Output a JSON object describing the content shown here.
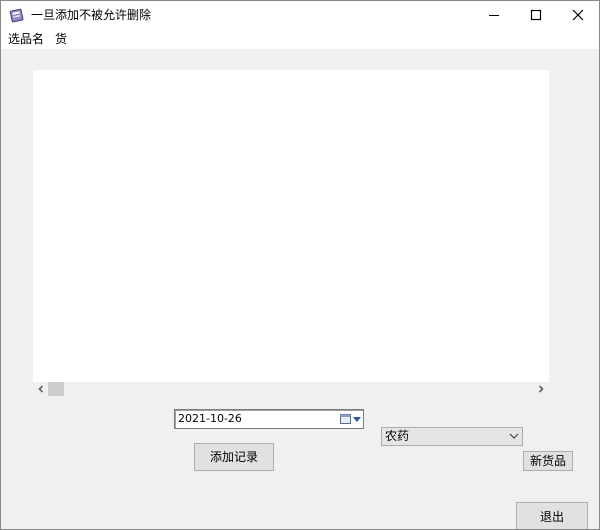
{
  "window": {
    "title": "一旦添加不被允许删除"
  },
  "menubar": {
    "items": [
      "选品名",
      "货"
    ]
  },
  "list": {
    "rows": []
  },
  "date_picker": {
    "value": "2021-10-26"
  },
  "category_select": {
    "selected": "农药"
  },
  "buttons": {
    "add_record": "添加记录",
    "new_goods": "新货品",
    "exit": "退出"
  },
  "icons": {
    "app": "app-icon",
    "minimize": "minimize-icon",
    "maximize": "maximize-icon",
    "close": "close-icon",
    "calendar": "calendar-icon",
    "dropdown": "chevron-down-icon"
  },
  "colors": {
    "window_bg": "#f0f0f0",
    "titlebar_bg": "#ffffff",
    "list_bg": "#ffffff",
    "button_bg": "#e1e1e1"
  }
}
